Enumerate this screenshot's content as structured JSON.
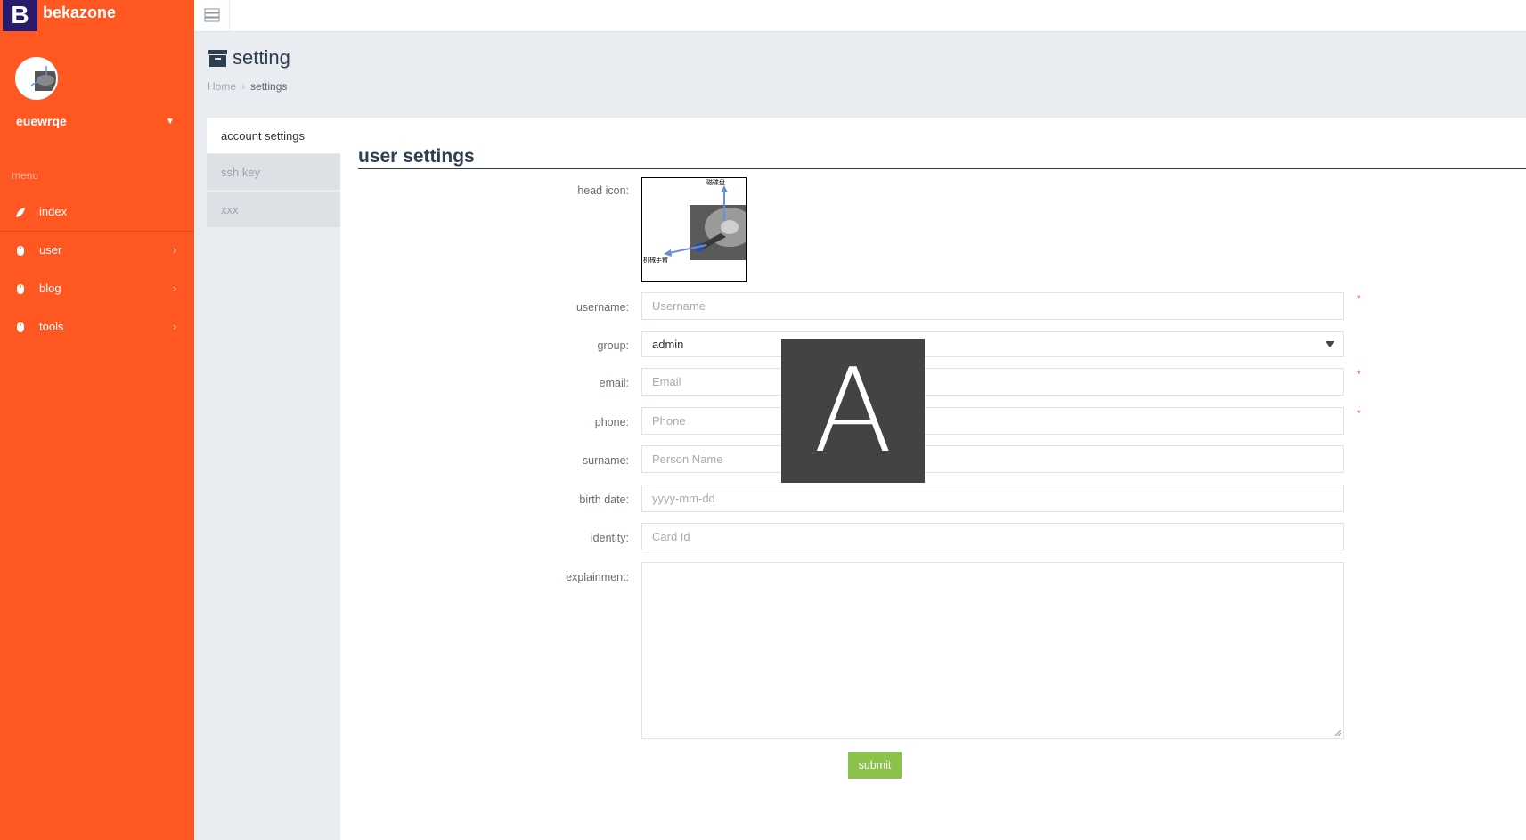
{
  "brand": {
    "logo_letter": "B",
    "name": "bekazone"
  },
  "user": {
    "name": "euewrqe"
  },
  "sidebar": {
    "menu_header": "menu",
    "items": [
      {
        "label": "index",
        "icon": "leaf-icon",
        "has_submenu": false
      },
      {
        "label": "user",
        "icon": "mouse-icon",
        "has_submenu": true
      },
      {
        "label": "blog",
        "icon": "mouse-icon",
        "has_submenu": true
      },
      {
        "label": "tools",
        "icon": "mouse-icon",
        "has_submenu": true
      }
    ]
  },
  "page": {
    "title": "setting",
    "breadcrumb": {
      "home": "Home",
      "current": "settings"
    }
  },
  "tabs": [
    "account settings",
    "ssh key",
    "xxx"
  ],
  "form": {
    "section_title": "user settings",
    "head_icon_label": "head icon:",
    "head_icon_caption_top": "磁碟盘",
    "head_icon_caption_bottom": "机械手臂",
    "fields": {
      "username": {
        "label": "username:",
        "placeholder": "Username",
        "required": true
      },
      "group": {
        "label": "group:",
        "value": "admin"
      },
      "email": {
        "label": "email:",
        "placeholder": "Email",
        "required": true
      },
      "phone": {
        "label": "phone:",
        "placeholder": "Phone",
        "required": true
      },
      "surname": {
        "label": "surname:",
        "placeholder": "Person Name"
      },
      "birth_date": {
        "label": "birth date:",
        "placeholder": "yyyy-mm-dd"
      },
      "identity": {
        "label": "identity:",
        "placeholder": "Card Id"
      },
      "explainment": {
        "label": "explainment:"
      }
    },
    "required_mark": "*",
    "submit_label": "submit"
  },
  "overlay": {
    "letter": "A"
  },
  "colors": {
    "sidebar": "#ff5722",
    "brand_logo_bg": "#2a1a6b",
    "submit": "#8bc34a",
    "content_bg": "#e9edf2",
    "overlay": "#434343"
  }
}
